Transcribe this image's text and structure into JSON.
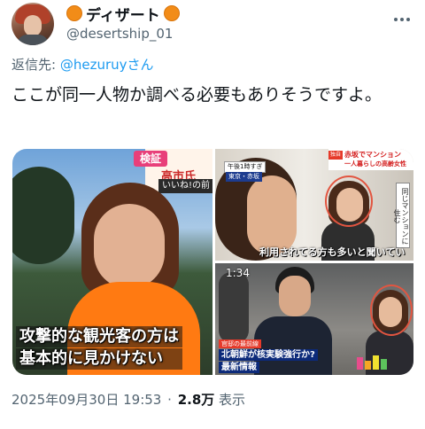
{
  "header": {
    "display_name": "ディザート",
    "handle": "@desertship_01",
    "avatar_icon": "user-avatar-icon",
    "more_icon": "more-options-icon"
  },
  "reply": {
    "prefix": "返信先:",
    "mention": "@hezuruyさん"
  },
  "tweet": {
    "text": "ここが同一人物か調べる必要もありそうですよ。"
  },
  "media": {
    "image1": {
      "sign_tag": "検証",
      "sign_text": "高市氏",
      "iine": "いいね!の前",
      "caption_line1": "攻撃的な観光客の方は",
      "caption_line2": "基本的に見かけない"
    },
    "image2": {
      "time": "午後1時すぎ",
      "location": "東京・赤坂",
      "banner_tag": "独自",
      "banner_line1": "赤坂でマンション",
      "banner_line2": "一人暮らしの高齢女性",
      "vertical_text": "同じマンションに住む",
      "subtitle": "利用されてる方も多いと聞いている"
    },
    "image3": {
      "time": "1:34",
      "tag": "官邸の最前線",
      "line1": "北朝鮮が核実験強行か?",
      "line2": "最新情報"
    }
  },
  "meta": {
    "datetime": "2025年09月30日 19:53",
    "separator": "·",
    "views_count": "2.8万",
    "views_label": "表示"
  },
  "colors": {
    "accent": "#1d9bf0",
    "emoji_orange": "#f28c18",
    "muted": "#536471",
    "highlight_circle": "#e25540"
  }
}
